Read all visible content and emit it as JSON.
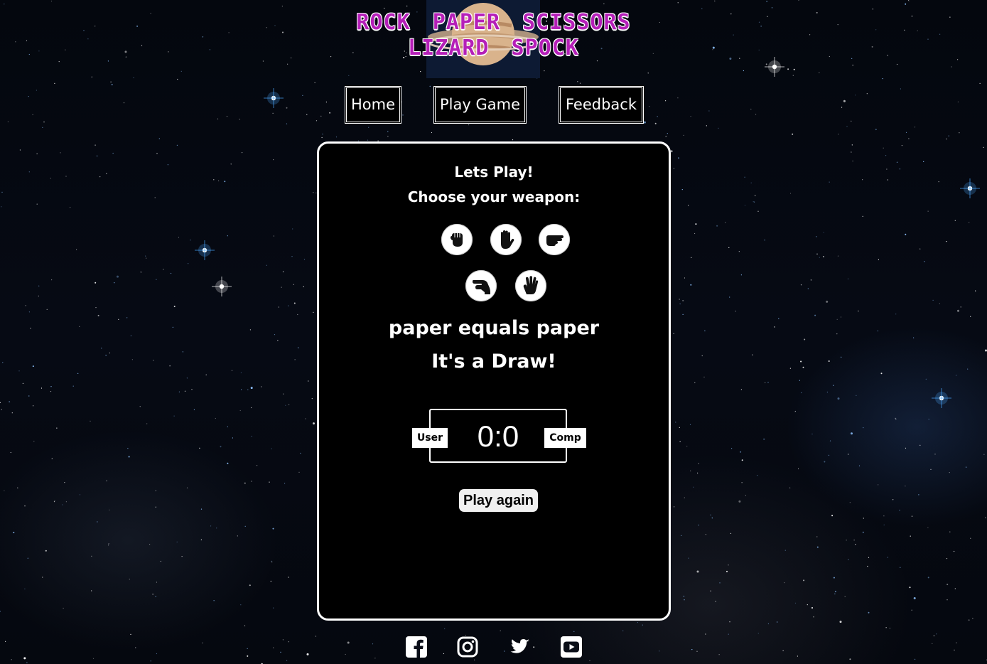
{
  "header": {
    "title_line1": "ROCK PAPER SCISSORS",
    "title_line2": "LIZARD SPOCK",
    "title_color": "#b51fb8"
  },
  "nav": {
    "items": [
      {
        "label": "Home"
      },
      {
        "label": "Play Game"
      },
      {
        "label": "Feedback"
      }
    ]
  },
  "game": {
    "heading": "Lets Play!",
    "prompt": "Choose your weapon:",
    "weapons": [
      {
        "name": "rock",
        "icon": "hand-rock-icon"
      },
      {
        "name": "paper",
        "icon": "hand-paper-icon"
      },
      {
        "name": "scissors",
        "icon": "hand-scissors-icon"
      },
      {
        "name": "lizard",
        "icon": "hand-lizard-icon"
      },
      {
        "name": "spock",
        "icon": "hand-spock-icon"
      }
    ],
    "result_line": "paper equals paper",
    "outcome": "It's a Draw!",
    "score": {
      "user_label": "User",
      "comp_label": "Comp",
      "display": "0:0",
      "user": 0,
      "comp": 0
    },
    "play_again_label": "Play again"
  },
  "footer": {
    "social_icons": [
      "facebook-icon",
      "instagram-icon",
      "twitter-icon",
      "youtube-icon"
    ]
  }
}
